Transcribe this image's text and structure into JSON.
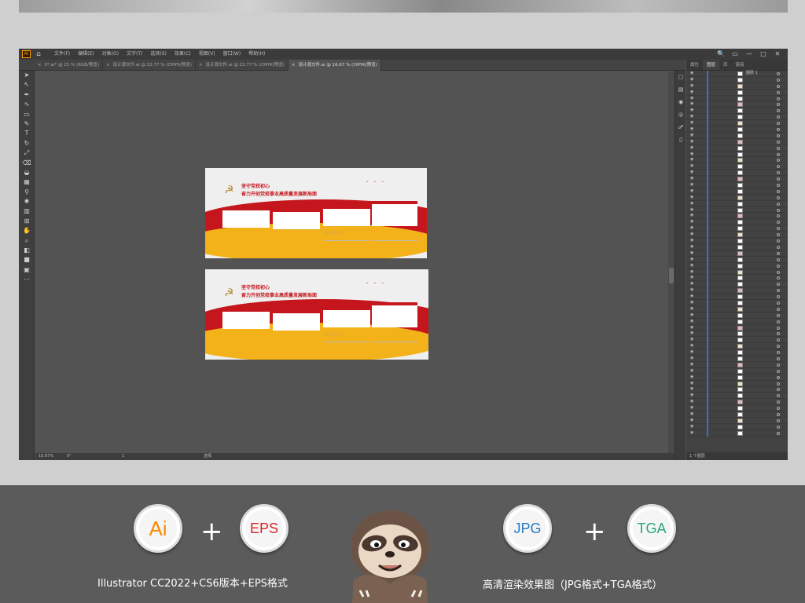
{
  "app": {
    "logo_label": "Ai",
    "menu": [
      "文件(F)",
      "编辑(E)",
      "对象(O)",
      "文字(T)",
      "选择(S)",
      "效果(C)",
      "视图(V)",
      "窗口(W)",
      "帮助(H)"
    ],
    "window_controls": [
      "🔍",
      "▭",
      "—",
      "□",
      "✕"
    ]
  },
  "tabs": [
    {
      "label": "0*.ai* @ 25 % (RGB/预览)",
      "active": false
    },
    {
      "label": "设计源文件.ai @ 22.77 % (CMYK/预览)",
      "active": false
    },
    {
      "label": "设计源文件.ai @ 22.77 % (CMYK/预览)",
      "active": false
    },
    {
      "label": "设计源文件.ai @ 16.67 % (CMYK/预览)",
      "active": true
    }
  ],
  "status": {
    "zoom": "16.67%",
    "rotation": "0°",
    "page": "1",
    "tool": "选择"
  },
  "layers_panel": {
    "tabs": [
      "属性",
      "图层",
      "库",
      "链接"
    ],
    "top_layer_name": "图层 1",
    "footer": "1 个图层"
  },
  "artboard": {
    "title_line1": "坚守党校初心",
    "title_line2": "奋力开创党校事业高质量发展新局面",
    "subtitle": "专题  回顾  展望"
  },
  "promo": {
    "badges": [
      "Ai",
      "EPS",
      "JPG",
      "TGA"
    ],
    "plus_left": "+",
    "plus_right": "+",
    "caption_left": "Illustrator CC2022+CS6版本+EPS格式",
    "caption_right": "高清渲染效果图（JPG格式+TGA格式）"
  },
  "colors": {
    "party_red": "#c4161c",
    "party_gold": "#f3b21a",
    "ai_orange": "#ff9a00",
    "eps_red": "#d7262c",
    "jpg_blue": "#2a7ac0",
    "tga_green": "#2aa582"
  }
}
